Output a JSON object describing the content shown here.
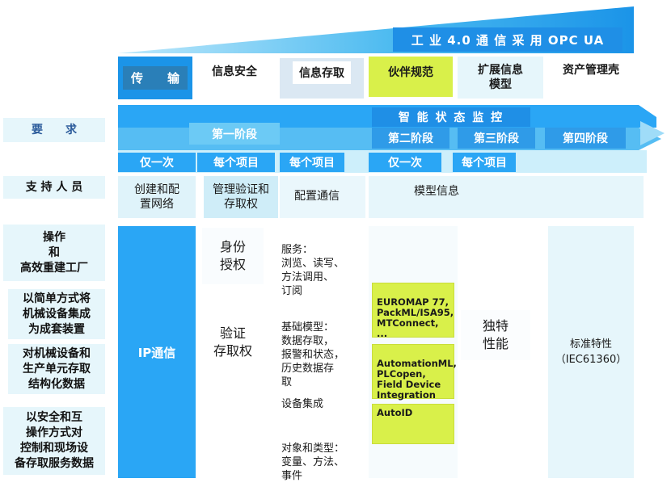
{
  "banner": {
    "title": "工 业 4.0 通 信 采 用 OPC UA"
  },
  "features": {
    "transport": "传　　输",
    "security": "信息安全",
    "access": "信息存取",
    "partners": "伙伴规范",
    "extended_info": "扩展信息模型",
    "asset_admin": "资产管理壳"
  },
  "timeline": {
    "condition_monitoring": "智 能 状 态 监 控",
    "stage1": "第一阶段",
    "stage2": "第二阶段",
    "stage3": "第三阶段",
    "stage4": "第四阶段"
  },
  "frequency": {
    "once_a": "仅一次",
    "per_project_a": "每个项目",
    "per_project_b": "每个项目",
    "once_b": "仅一次",
    "per_project_c": "每个项目"
  },
  "tasks": {
    "create_config_network": "创建和配置网络",
    "manage_auth": "管理验证和存取权",
    "config_comm": "配置通信",
    "model_info": "模型信息"
  },
  "left_labels": {
    "requirements": "要　　求",
    "support_staff": "支 持 人 员",
    "operation": "操作\n和\n高效重建工厂",
    "integrate": "以简单方式将\n机械设备集成\n为成套装置",
    "access_data": "对机械设备和\n生产单元存取\n结构化数据",
    "secure_access": "以安全和互\n操作方式对\n控制和现场设\n备存取服务数据"
  },
  "body": {
    "ip_comm": "IP通信",
    "identity_auth": "身份\n授权",
    "verify_access": "验证\n存取权",
    "services": "服务：\n浏览、读写、\n方法调用、\n订阅",
    "base_model": "基础模型：\n数据存取，\n报警和状态，\n历史数据存\n取",
    "device_integration": "设备集成",
    "objects_types": "对象和类型：\n变量、方法、\n事件",
    "standards_1": "EUROMAP 77,\nPackML/ISA95,\nMTConnect, ...",
    "standards_2": "AutomationML,\nPLCopen,\nField Device\nIntegration",
    "standards_3": "AutoID",
    "unique_features": "独特\n性能",
    "standard_features": "标准特性\n（IEC61360）"
  },
  "colors": {
    "primary_blue": "#1f8fe6",
    "light_blue": "#e6f6fb",
    "yellow_green": "#d9f04a",
    "bright_blue": "#2aa6f5"
  }
}
